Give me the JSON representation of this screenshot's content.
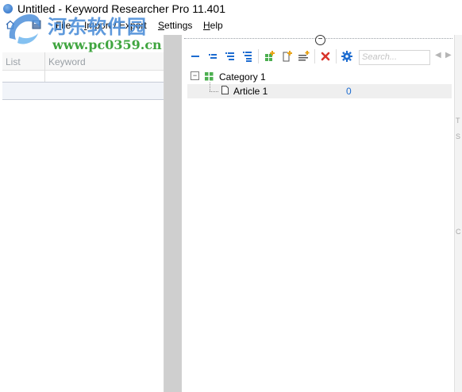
{
  "window": {
    "title": "Untitled - Keyword Researcher Pro 11.401"
  },
  "menu": {
    "file_prefix": "",
    "file_u": "F",
    "file_rest": "ile",
    "import_export_u": "I",
    "import_export_rest": "mport / Export",
    "settings_u": "S",
    "settings_rest": "ettings",
    "help_u": "H",
    "help_rest": "elp"
  },
  "watermark": {
    "site_name": "河东软件园",
    "url": "www.pc0359.cn"
  },
  "left_grid": {
    "columns": [
      "List",
      "Keyword"
    ]
  },
  "right_panel": {
    "collapse_glyph": "−",
    "search": {
      "placeholder": "Search...",
      "value": ""
    },
    "tree": {
      "category": "Category 1",
      "expander_glyph": "−",
      "articles": [
        {
          "title": "Article 1",
          "count": "0"
        }
      ]
    },
    "edge_letters": [
      "T",
      "S",
      "C"
    ]
  },
  "colors": {
    "accent_blue": "#1d6cd0",
    "splitter": "#cfcfcf",
    "delete_red": "#d9342b",
    "add_green": "#4caf50"
  }
}
